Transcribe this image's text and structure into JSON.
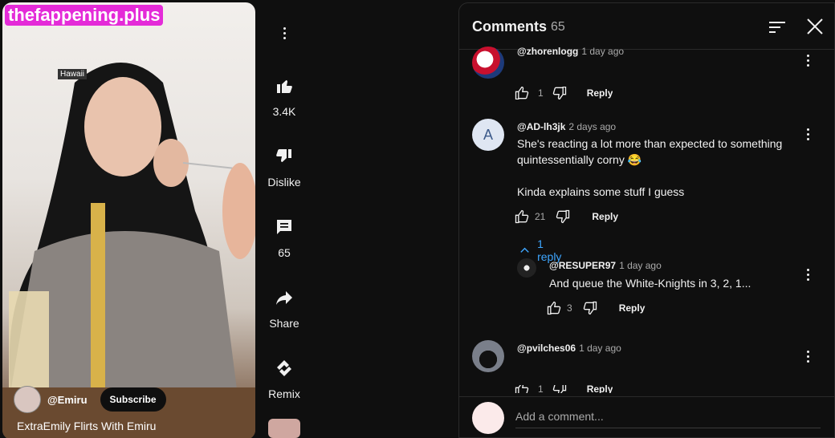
{
  "video": {
    "watermark": "thefappening.plus",
    "location_tag": "Hawaii",
    "channel": "@Emiru",
    "subscribe_label": "Subscribe",
    "title": "ExtraEmily Flirts With Emiru"
  },
  "actions": {
    "likes": "3.4K",
    "dislike_label": "Dislike",
    "comment_count": "65",
    "share_label": "Share",
    "remix_label": "Remix"
  },
  "comments_panel": {
    "title": "Comments",
    "count": "65",
    "comments": [
      {
        "user": "@zhorenlogg",
        "ago": "1 day ago",
        "text": [],
        "likes": "1",
        "reply_label": "Reply"
      },
      {
        "user": "@AD-lh3jk",
        "ago": "2 days ago",
        "text": [
          "She's reacting a lot more than expected to something",
          "quintessentially corny 😂",
          "",
          "Kinda explains some stuff I guess"
        ],
        "likes": "21",
        "reply_label": "Reply",
        "avatar_letter": "A"
      },
      {
        "user": "@RESUPER97",
        "ago": "1 day ago",
        "text": [
          "And queue the White-Knights in 3, 2, 1..."
        ],
        "likes": "3",
        "reply_label": "Reply"
      },
      {
        "user": "@pvilches06",
        "ago": "1 day ago",
        "text": [],
        "likes": "1",
        "reply_label": "Reply"
      }
    ],
    "replies_toggle": "1 reply",
    "add_comment_placeholder": "Add a comment..."
  }
}
